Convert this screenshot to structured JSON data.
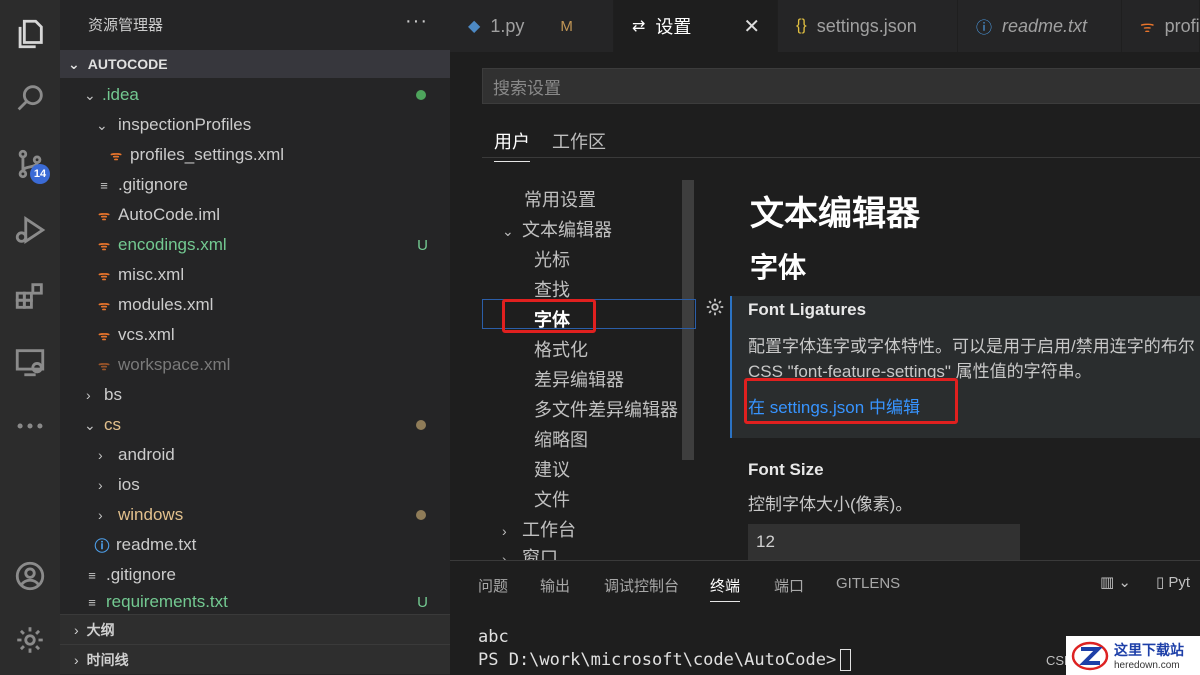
{
  "activity_bar": {
    "scm_badge": "14"
  },
  "explorer": {
    "title": "资源管理器",
    "more": "···",
    "root": "AUTOCODE",
    "tree": [
      {
        "label": ".idea"
      },
      {
        "label": "inspectionProfiles"
      },
      {
        "label": "profiles_settings.xml"
      },
      {
        "label": ".gitignore"
      },
      {
        "label": "AutoCode.iml"
      },
      {
        "label": "encodings.xml",
        "status": "U"
      },
      {
        "label": "misc.xml"
      },
      {
        "label": "modules.xml"
      },
      {
        "label": "vcs.xml"
      },
      {
        "label": "workspace.xml"
      },
      {
        "label": "bs"
      },
      {
        "label": "cs"
      },
      {
        "label": "android"
      },
      {
        "label": "ios"
      },
      {
        "label": "windows"
      },
      {
        "label": "readme.txt"
      },
      {
        "label": ".gitignore"
      },
      {
        "label": "requirements.txt",
        "status": "U"
      }
    ],
    "sections": [
      {
        "label": "大纲"
      },
      {
        "label": "时间线"
      }
    ]
  },
  "tabs": [
    {
      "label": "1.py",
      "status": "M",
      "icon": "python-icon"
    },
    {
      "label": "设置",
      "icon": "settings-sliders-icon",
      "close": "✕"
    },
    {
      "label": "settings.json",
      "icon": "json-braces-icon",
      "icon_text": "{}"
    },
    {
      "label": "readme.txt",
      "icon": "info-icon"
    },
    {
      "label": "profi",
      "icon": "rss-icon"
    }
  ],
  "settings": {
    "search_placeholder": "搜索设置",
    "scopes": [
      "用户",
      "工作区"
    ],
    "toc": [
      {
        "label": "常用设置"
      },
      {
        "label": "文本编辑器"
      },
      {
        "label": "光标"
      },
      {
        "label": "查找"
      },
      {
        "label": "字体"
      },
      {
        "label": "格式化"
      },
      {
        "label": "差异编辑器"
      },
      {
        "label": "多文件差异编辑器"
      },
      {
        "label": "缩略图"
      },
      {
        "label": "建议"
      },
      {
        "label": "文件"
      },
      {
        "label": "工作台"
      },
      {
        "label": "窗口"
      }
    ],
    "heading": "文本编辑器",
    "subheading": "字体",
    "ligatures": {
      "title": "Font Ligatures",
      "desc_line1": "配置字体连字或字体特性。可以是用于启用/禁用连字的布尔",
      "desc_line2": "CSS \"font-feature-settings\" 属性值的字符串。",
      "link": "在 settings.json 中编辑"
    },
    "font_size": {
      "title": "Font Size",
      "desc": "控制字体大小(像素)。",
      "value": "12"
    }
  },
  "panel": {
    "tabs": [
      "问题",
      "输出",
      "调试控制台",
      "终端",
      "端口",
      "GITLENS"
    ],
    "right_label": "Pyt",
    "terminal_line1": "abc",
    "terminal_line2": "PS D:\\work\\microsoft\\code\\AutoCode>",
    "side_text": "CSD"
  },
  "watermark": {
    "cn": "这里下载站",
    "en": "heredown.com"
  },
  "colors": {
    "accent": "#3794ff",
    "highlight_box": "#e0201f",
    "untracked": "#73c991",
    "modified": "#c09555"
  }
}
